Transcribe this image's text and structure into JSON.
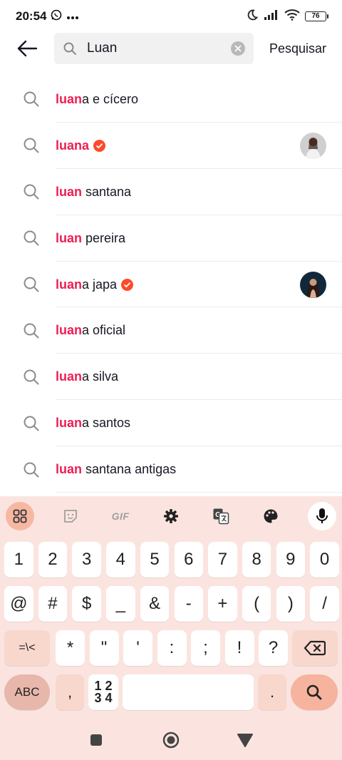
{
  "status": {
    "time": "20:54",
    "battery": "76"
  },
  "search": {
    "value": "Luan",
    "action_label": "Pesquisar"
  },
  "suggestions": [
    {
      "highlight": "luan",
      "rest": "a e cícero",
      "verified": false,
      "has_thumb": false
    },
    {
      "highlight": "luana",
      "rest": "",
      "verified": true,
      "has_thumb": true
    },
    {
      "highlight": "luan",
      "rest": " santana",
      "verified": false,
      "has_thumb": false
    },
    {
      "highlight": "luan",
      "rest": " pereira",
      "verified": false,
      "has_thumb": false
    },
    {
      "highlight": "luan",
      "rest": "a japa",
      "verified": true,
      "has_thumb": true
    },
    {
      "highlight": "luan",
      "rest": "a oficial",
      "verified": false,
      "has_thumb": false
    },
    {
      "highlight": "luan",
      "rest": "a silva",
      "verified": false,
      "has_thumb": false
    },
    {
      "highlight": "luan",
      "rest": "a santos",
      "verified": false,
      "has_thumb": false
    },
    {
      "highlight": "luan",
      "rest": " santana antigas",
      "verified": false,
      "has_thumb": false
    }
  ],
  "keyboard": {
    "toolbar": {
      "gif_label": "GIF"
    },
    "row1": [
      "1",
      "2",
      "3",
      "4",
      "5",
      "6",
      "7",
      "8",
      "9",
      "0"
    ],
    "row2": [
      "@",
      "#",
      "$",
      "_",
      "&",
      "-",
      "+",
      "(",
      ")",
      "/"
    ],
    "row3": {
      "switch_label": "=\\<",
      "keys": [
        "*",
        "\"",
        "'",
        ":",
        ";",
        "!",
        "?"
      ]
    },
    "row4": {
      "abc_label": "ABC",
      "comma": ",",
      "numpad_top": "1 2",
      "numpad_bottom": "3 4",
      "period": "."
    }
  },
  "colors": {
    "highlight": "#ee1d52",
    "verified": "#fe4a2a",
    "keyboard_bg": "#fbe4df",
    "enter_key": "#f6b39d"
  }
}
